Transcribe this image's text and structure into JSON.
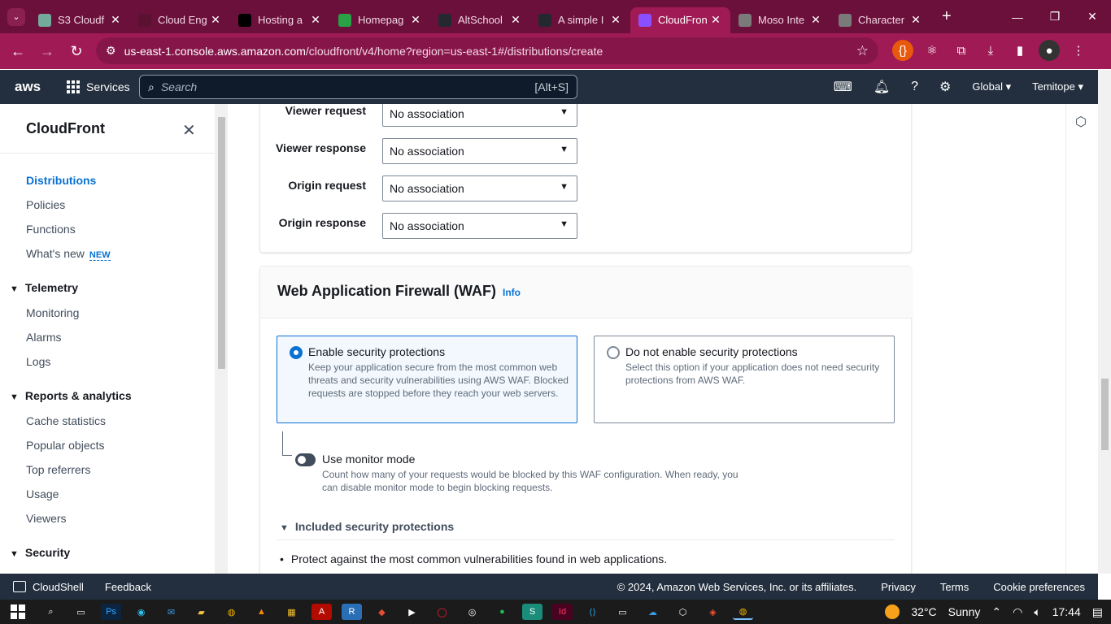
{
  "browser": {
    "tabs": [
      {
        "title": "S3 Cloudf",
        "icon": "chatgpt-icon",
        "color": "#74aa9c"
      },
      {
        "title": "Cloud Eng",
        "icon": "app-icon",
        "color": "#5a1230"
      },
      {
        "title": "Hosting a",
        "icon": "medium-icon",
        "color": "#000000"
      },
      {
        "title": "Homepag",
        "icon": "code-icon",
        "color": "#2aa146"
      },
      {
        "title": "AltSchool",
        "icon": "github-icon",
        "color": "#24292f"
      },
      {
        "title": "A simple I",
        "icon": "github-icon",
        "color": "#24292f"
      },
      {
        "title": "CloudFron",
        "icon": "cloudfront-icon",
        "color": "#8c4fff",
        "active": true
      },
      {
        "title": "Moso Inte",
        "icon": "globe-icon",
        "color": "#7a7a7a"
      },
      {
        "title": "Character",
        "icon": "globe-icon",
        "color": "#7a7a7a"
      }
    ],
    "url_host": "us-east-1.console.aws.amazon.com",
    "url_path": "/cloudfront/v4/home?region=us-east-1#/distributions/create"
  },
  "awsnav": {
    "logo": "aws",
    "services": "Services",
    "search_placeholder": "Search",
    "search_shortcut": "[Alt+S]",
    "region": "Global",
    "user": "Temitope"
  },
  "sidebar": {
    "title": "CloudFront",
    "items": [
      "Distributions",
      "Policies",
      "Functions",
      "What's new"
    ],
    "new_badge": "NEW",
    "telemetry": {
      "title": "Telemetry",
      "items": [
        "Monitoring",
        "Alarms",
        "Logs"
      ]
    },
    "reports": {
      "title": "Reports & analytics",
      "items": [
        "Cache statistics",
        "Popular objects",
        "Top referrers",
        "Usage",
        "Viewers"
      ]
    },
    "security": {
      "title": "Security"
    }
  },
  "associations": [
    {
      "label": "Viewer request",
      "value": "No association"
    },
    {
      "label": "Viewer response",
      "value": "No association"
    },
    {
      "label": "Origin request",
      "value": "No association"
    },
    {
      "label": "Origin response",
      "value": "No association"
    }
  ],
  "waf": {
    "title": "Web Application Firewall (WAF)",
    "info": "Info",
    "enable": {
      "label": "Enable security protections",
      "desc": "Keep your application secure from the most common web threats and security vulnerabilities using AWS WAF. Blocked requests are stopped before they reach your web servers.",
      "selected": true
    },
    "disable": {
      "label": "Do not enable security protections",
      "desc": "Select this option if your application does not need security protections from AWS WAF.",
      "selected": false
    },
    "monitor": {
      "label": "Use monitor mode",
      "desc": "Count how many of your requests would be blocked by this WAF configuration. When ready, you can disable monitor mode to begin blocking requests.",
      "on": false
    },
    "included_title": "Included security protections",
    "included_items": [
      "Protect against the most common vulnerabilities found in web applications."
    ]
  },
  "footer": {
    "cloudshell": "CloudShell",
    "feedback": "Feedback",
    "copyright": "© 2024, Amazon Web Services, Inc. or its affiliates.",
    "privacy": "Privacy",
    "terms": "Terms",
    "cookies": "Cookie preferences"
  },
  "taskbar": {
    "weather": "32°C",
    "weather_desc": "Sunny",
    "time": "17:44"
  },
  "colors": {
    "aws_nav": "#232f3e",
    "link": "#0972d3",
    "browser_frame": "#a01b56"
  }
}
